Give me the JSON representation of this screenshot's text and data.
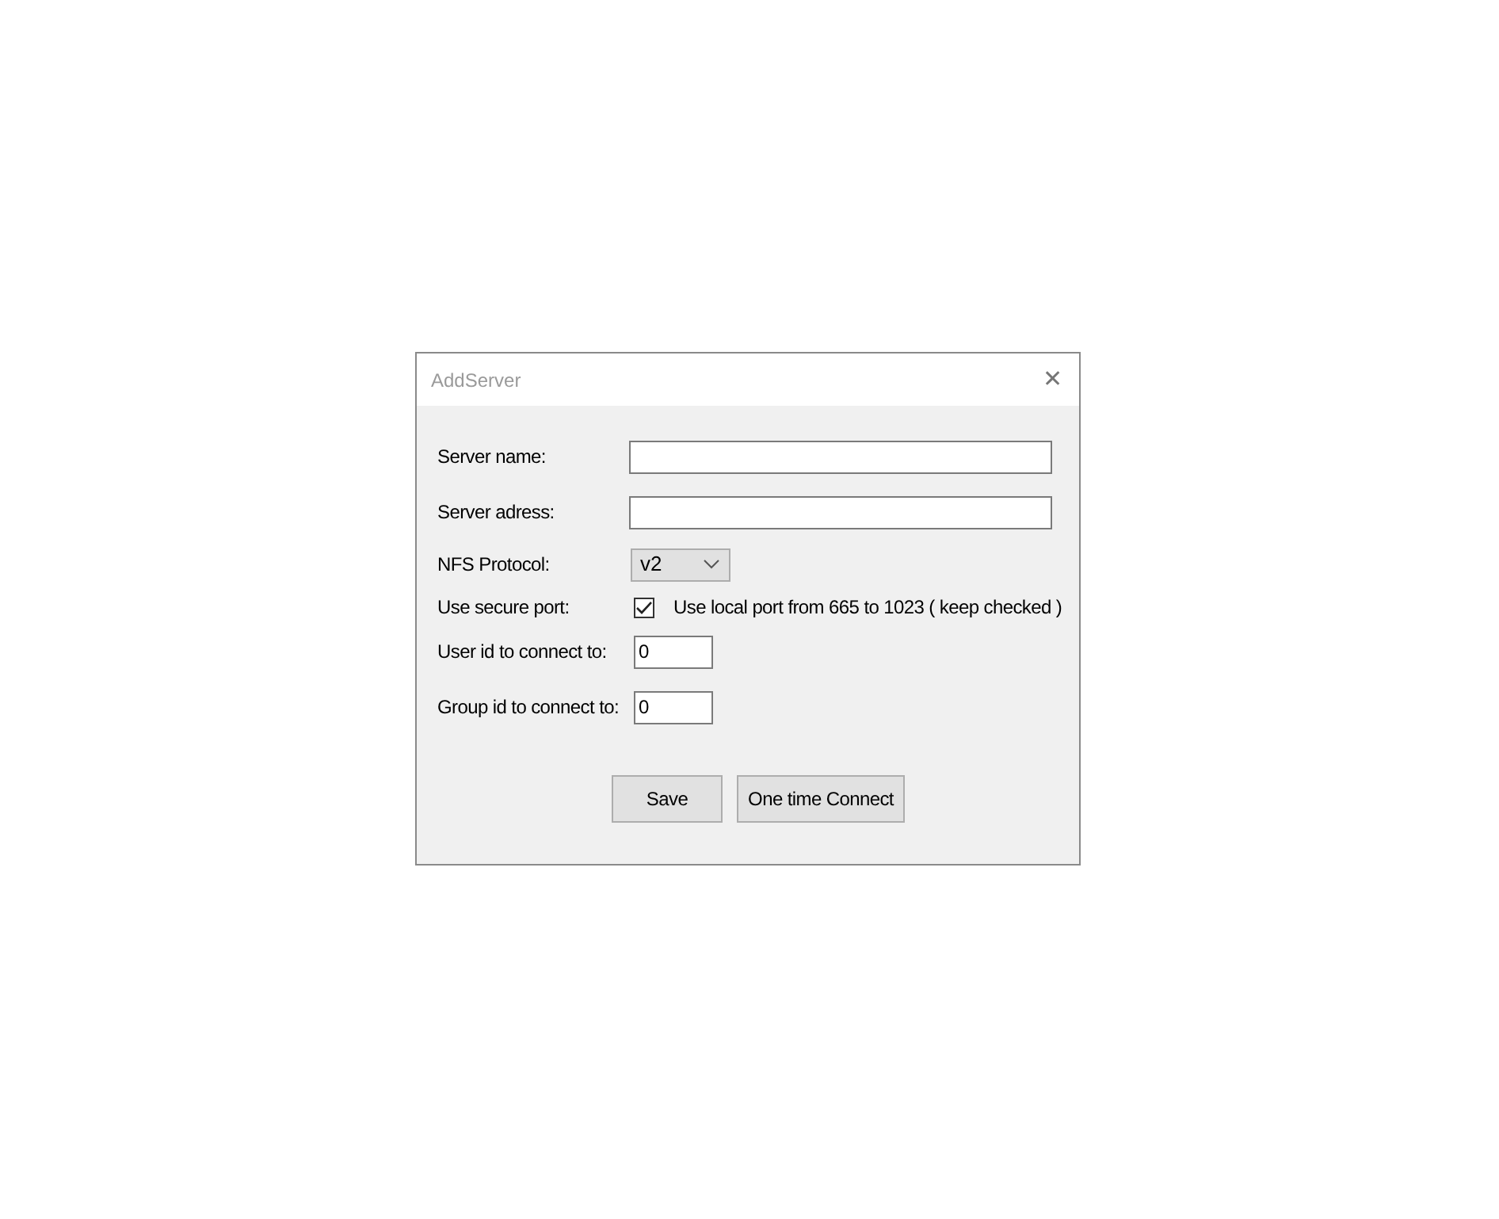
{
  "window": {
    "title": "AddServer",
    "close": "✕"
  },
  "fields": [
    {
      "kind": "text",
      "label": "Server name:"
    },
    {
      "kind": "text",
      "label": "Server adress:"
    },
    {
      "kind": "combo",
      "label": "NFS Protocol:",
      "value": "v2"
    },
    {
      "kind": "checkbox",
      "label": "Use secure port:",
      "text": "Use local port from 665 to 1023 ( keep checked )",
      "checked": true
    },
    {
      "kind": "number",
      "label": "User id to connect to:",
      "value": "0"
    },
    {
      "kind": "number",
      "label": "Group id to connect to:",
      "value": "0"
    }
  ],
  "buttons": [
    "Save",
    "One time Connect"
  ]
}
